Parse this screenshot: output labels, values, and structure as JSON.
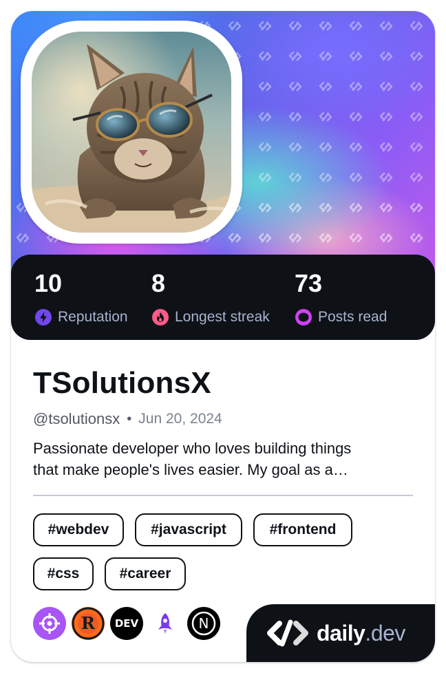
{
  "profile": {
    "name": "TSolutionsX",
    "handle": "@tsolutionsx",
    "separator": "•",
    "joined": "Jun 20, 2024",
    "bio_line1": "Passionate developer who loves building things",
    "bio_line2": "that make people's lives easier. My goal as a…"
  },
  "stats": [
    {
      "value": "10",
      "label": "Reputation",
      "icon": "lightning-icon",
      "color": "#7147ed"
    },
    {
      "value": "8",
      "label": "Longest streak",
      "icon": "flame-icon",
      "color": "#ff5a8a"
    },
    {
      "value": "73",
      "label": "Posts read",
      "icon": "eye-icon",
      "color": "#d042f5"
    }
  ],
  "tags": [
    "#webdev",
    "#javascript",
    "#frontend",
    "#css",
    "#career"
  ],
  "sources": [
    {
      "name": "crosshair-source-icon",
      "color": "#a855f7"
    },
    {
      "name": "r-source-icon",
      "color": "#ff6b1a"
    },
    {
      "name": "dev-source-icon",
      "label": "DEV",
      "color": "#000000"
    },
    {
      "name": "rocket-source-icon",
      "color": "#7c3aed"
    },
    {
      "name": "n-source-icon",
      "label": "N",
      "color": "#000000"
    }
  ],
  "brand": {
    "name": "daily",
    "tld": ".dev"
  },
  "colors": {
    "background": "#0e1217",
    "muted": "#a8b3cf"
  }
}
